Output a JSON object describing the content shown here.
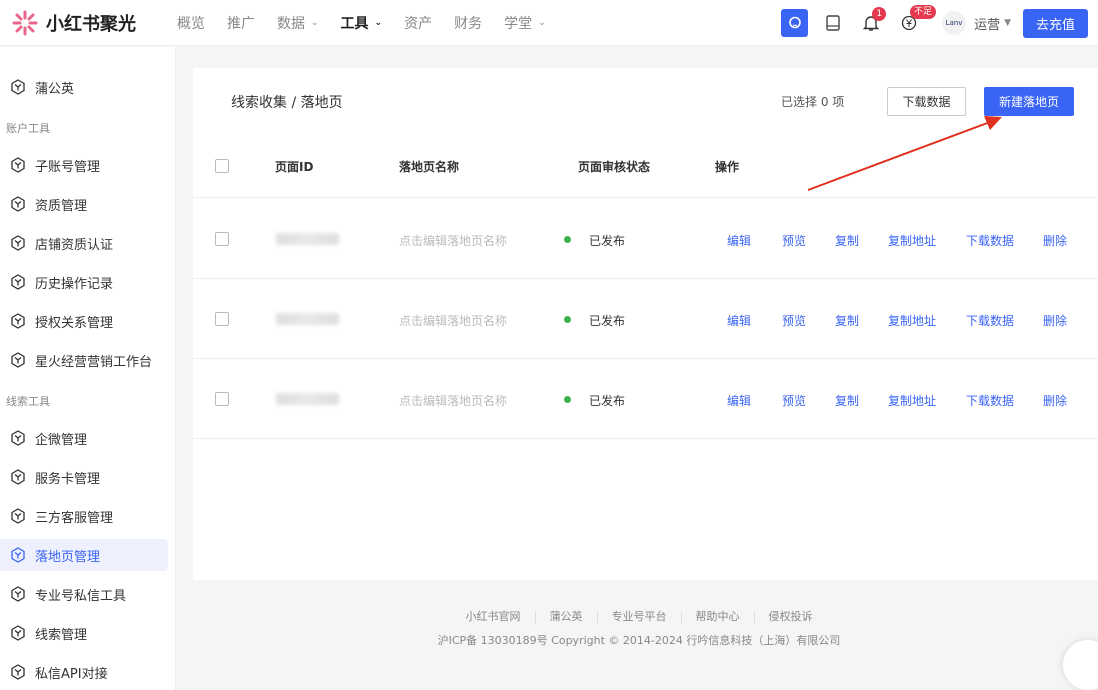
{
  "brand": {
    "name": "小红书聚光"
  },
  "nav": [
    {
      "label": "概览"
    },
    {
      "label": "推广"
    },
    {
      "label": "数据",
      "chevron": true
    },
    {
      "label": "工具",
      "chevron": true,
      "active": true
    },
    {
      "label": "资产"
    },
    {
      "label": "财务"
    },
    {
      "label": "学堂",
      "chevron": true
    }
  ],
  "header": {
    "notif_count": "1",
    "balance_badge": "不足",
    "avatar_text": "Lanv",
    "user": "运营",
    "recharge": "去充值"
  },
  "sidebar": {
    "items": [
      {
        "label": "蒲公英"
      }
    ],
    "group1": "账户工具",
    "items1": [
      {
        "label": "子账号管理"
      },
      {
        "label": "资质管理"
      },
      {
        "label": "店铺资质认证"
      },
      {
        "label": "历史操作记录"
      },
      {
        "label": "授权关系管理"
      },
      {
        "label": "星火经营营销工作台"
      }
    ],
    "group2": "线索工具",
    "items2": [
      {
        "label": "企微管理"
      },
      {
        "label": "服务卡管理"
      },
      {
        "label": "三方客服管理"
      },
      {
        "label": "落地页管理",
        "active": true
      },
      {
        "label": "专业号私信工具"
      },
      {
        "label": "线索管理"
      },
      {
        "label": "私信API对接"
      }
    ]
  },
  "main": {
    "breadcrumb": "线索收集 / 落地页",
    "selected": "已选择 0 项",
    "download": "下载数据",
    "new_page": "新建落地页",
    "columns": [
      "页面ID",
      "落地页名称",
      "页面审核状态",
      "操作"
    ],
    "rows": [
      {
        "name_placeholder": "点击编辑落地页名称",
        "status": "已发布"
      },
      {
        "name_placeholder": "点击编辑落地页名称",
        "status": "已发布"
      },
      {
        "name_placeholder": "点击编辑落地页名称",
        "status": "已发布"
      }
    ],
    "actions": [
      "编辑",
      "预览",
      "复制",
      "复制地址",
      "下载数据",
      "删除"
    ]
  },
  "footer": {
    "links": [
      "小红书官网",
      "蒲公英",
      "专业号平台",
      "帮助中心",
      "侵权投诉"
    ],
    "copyright": "沪ICP备 13030189号 Copyright © 2014-2024 行吟信息科技（上海）有限公司"
  },
  "colors": {
    "accent": "#3a64f3",
    "badge": "#e53950",
    "published": "#3cb14a"
  }
}
